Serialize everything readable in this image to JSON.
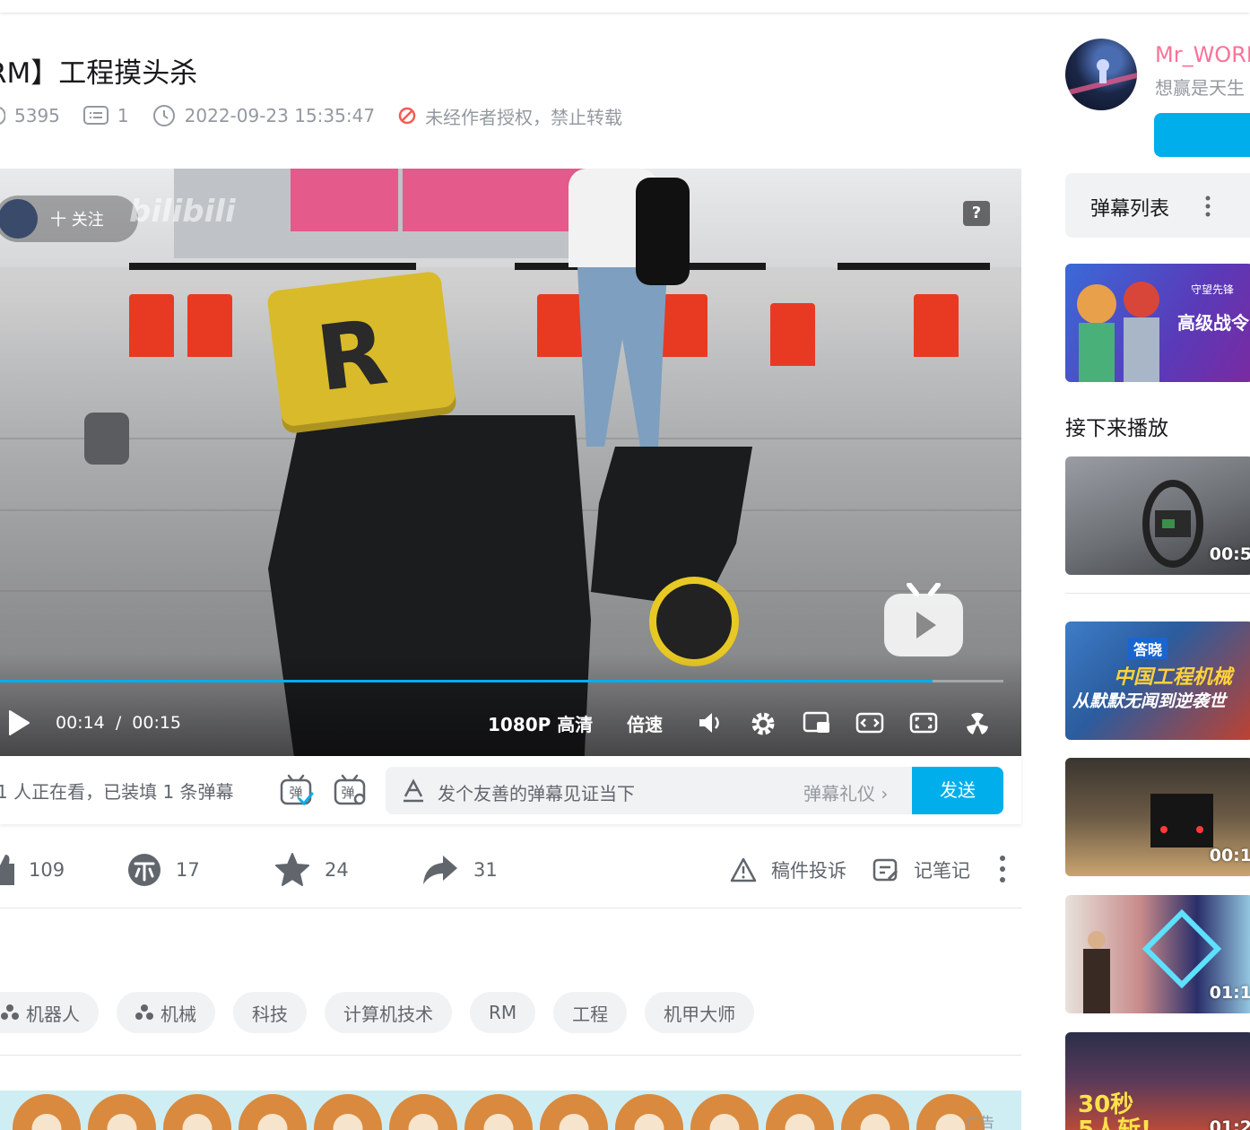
{
  "video": {
    "title": "RM】工程摸头杀",
    "views": "5395",
    "comments": "1",
    "pubdate": "2022-09-23 15:35:47",
    "copyright": "未经作者授权，禁止转载"
  },
  "player": {
    "follow_label": "十 关注",
    "help_label": "?",
    "time_current": "00:14",
    "time_separator": "/",
    "time_total": "00:15",
    "progress": 0.93,
    "quality": "1080P 高清",
    "speed": "倍速"
  },
  "danmaku": {
    "viewers_text": "1 人正在看，已装填 1 条弹幕",
    "placeholder": "发个友善的弹幕见证当下",
    "etiquette": "弹幕礼仪 ›",
    "send": "发送"
  },
  "actions": {
    "like": "109",
    "coin": "17",
    "favorite": "24",
    "share": "31",
    "report": "稿件投诉",
    "notes": "记笔记"
  },
  "tags": [
    {
      "label": "机器人",
      "icon": true
    },
    {
      "label": "机械",
      "icon": true
    },
    {
      "label": "科技",
      "icon": false
    },
    {
      "label": "计算机技术",
      "icon": false
    },
    {
      "label": "RM",
      "icon": false
    },
    {
      "label": "工程",
      "icon": false
    },
    {
      "label": "机甲大师",
      "icon": false
    }
  ],
  "banner": {
    "ad_label": "广告"
  },
  "uploader": {
    "name": "Mr_WORL",
    "sign": "想赢是天生"
  },
  "sidebar": {
    "danmaku_list": "弹幕列表",
    "ad_title": "高级战令",
    "ad_subtitle": "守望先锋",
    "next_title": "接下来播放",
    "recommendations": [
      {
        "duration": "00:5"
      },
      {
        "duration": ""
      },
      {
        "duration": "00:1"
      },
      {
        "duration": "01:1"
      },
      {
        "duration": "01:2"
      }
    ],
    "rec2_text": "中国工程机械",
    "rec2_text2": "从默默无闻到逆袭世",
    "rec2_badge": "答晓",
    "rec5_text": "30秒",
    "rec5_text2": "5人斩!"
  },
  "colors": {
    "accent": "#00aeec",
    "uploader_name": "#fb7299",
    "copyright_icon": "#f85a54"
  }
}
